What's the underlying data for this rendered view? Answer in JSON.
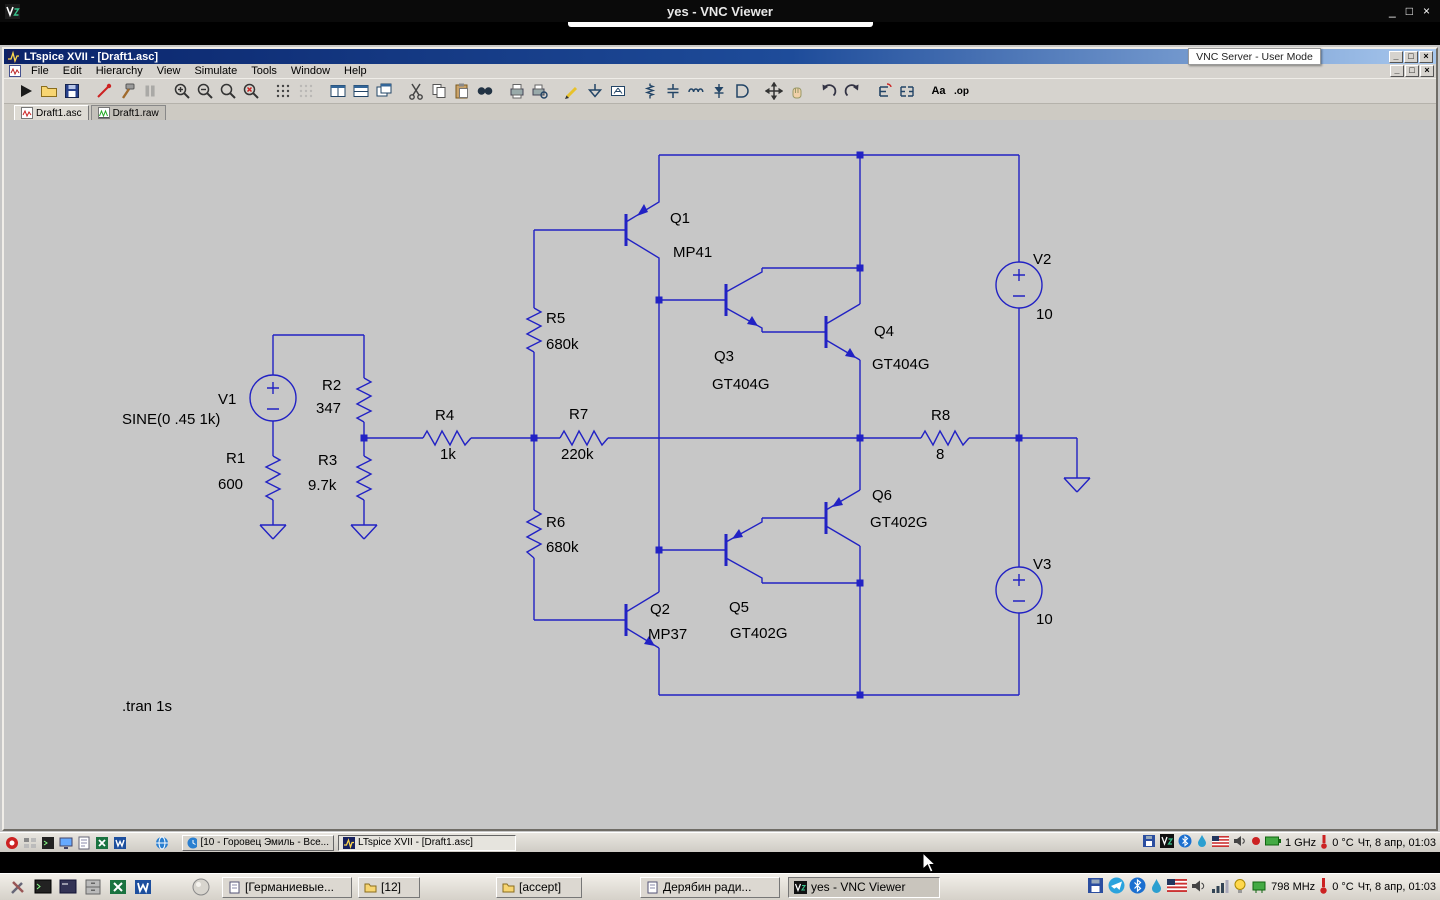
{
  "vnc_viewer": {
    "title": "yes - VNC Viewer",
    "controls": {
      "minimize": "_",
      "maximize": "□",
      "close": "×"
    }
  },
  "vnc_server_badge": "VNC Server - User Mode",
  "ltspice": {
    "title": "LTspice XVII - [Draft1.asc]",
    "menu": [
      "File",
      "Edit",
      "Hierarchy",
      "View",
      "Simulate",
      "Tools",
      "Window",
      "Help"
    ],
    "tabs": [
      "Draft1.asc",
      "Draft1.raw"
    ],
    "controls": {
      "minimize": "_",
      "restore": "□",
      "close": "×"
    },
    "toolbar": {
      "text_tool": "Aa",
      "spice_directive_tool": ".op",
      "icons": [
        "run",
        "open",
        "save",
        "probe",
        "control-panel",
        "halt",
        "zoom-in",
        "zoom-out",
        "zoom-full",
        "zoom-area",
        "grid",
        "grid-off",
        "tile-vertical",
        "tile-horizontal",
        "cascade",
        "cut",
        "copy",
        "paste",
        "find",
        "print",
        "print-preview",
        "draw-wire",
        "ground",
        "net-label",
        "resistor",
        "capacitor",
        "inductor",
        "diode",
        "component",
        "move",
        "drag",
        "undo",
        "redo",
        "rotate",
        "mirror",
        "text",
        "spice-directive"
      ]
    }
  },
  "schematic": {
    "directive": ".tran 1s",
    "components": {
      "V1": {
        "name": "V1",
        "value": "SINE(0 .45 1k)"
      },
      "V2": {
        "name": "V2",
        "value": "10"
      },
      "V3": {
        "name": "V3",
        "value": "10"
      },
      "R1": {
        "name": "R1",
        "value": "600"
      },
      "R2": {
        "name": "R2",
        "value": "347"
      },
      "R3": {
        "name": "R3",
        "value": "9.7k"
      },
      "R4": {
        "name": "R4",
        "value": "1k"
      },
      "R5": {
        "name": "R5",
        "value": "680k"
      },
      "R6": {
        "name": "R6",
        "value": "680k"
      },
      "R7": {
        "name": "R7",
        "value": "220k"
      },
      "R8": {
        "name": "R8",
        "value": "8"
      },
      "Q1": {
        "name": "Q1",
        "value": "MP41"
      },
      "Q2": {
        "name": "Q2",
        "value": "MP37"
      },
      "Q3": {
        "name": "Q3",
        "value": "GT404G"
      },
      "Q4": {
        "name": "Q4",
        "value": "GT404G"
      },
      "Q5": {
        "name": "Q5",
        "value": "GT402G"
      },
      "Q6": {
        "name": "Q6",
        "value": "GT402G"
      }
    }
  },
  "remote_taskbar": {
    "tasks": [
      "[10 - Горовец Эмиль - Все...",
      "LTspice XVII - [Draft1.asc]"
    ],
    "cpu": "1 GHz",
    "temperature": "0 °C",
    "clock": "Чт, 8 апр, 01:03"
  },
  "host_taskbar": {
    "tasks": [
      "[Германиевые...",
      "[12]",
      "[accept]",
      "Дерябин ради...",
      "yes - VNC Viewer"
    ],
    "cpu": "798 MHz",
    "temperature": "0 °C",
    "clock": "Чт, 8 апр, 01:03"
  }
}
